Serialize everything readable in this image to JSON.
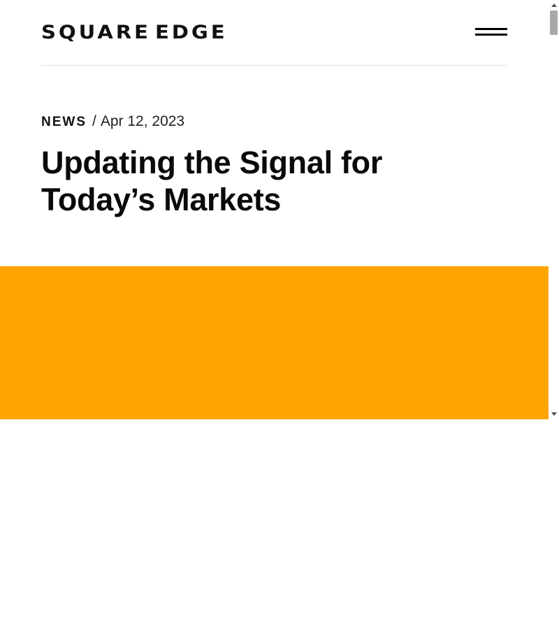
{
  "header": {
    "logo_word_1": "SQUARE",
    "logo_word_2": "EDGE",
    "menu_icon": "hamburger-menu-icon"
  },
  "article": {
    "category": "NEWS",
    "separator": "/",
    "date": "Apr 12, 2023",
    "title": "Updating the Signal for Today’s Markets"
  },
  "hero": {
    "background_color": "#ffa400"
  },
  "colors": {
    "text": "#0a0a0a",
    "divider": "#e2e2e2",
    "accent": "#ffa400"
  }
}
